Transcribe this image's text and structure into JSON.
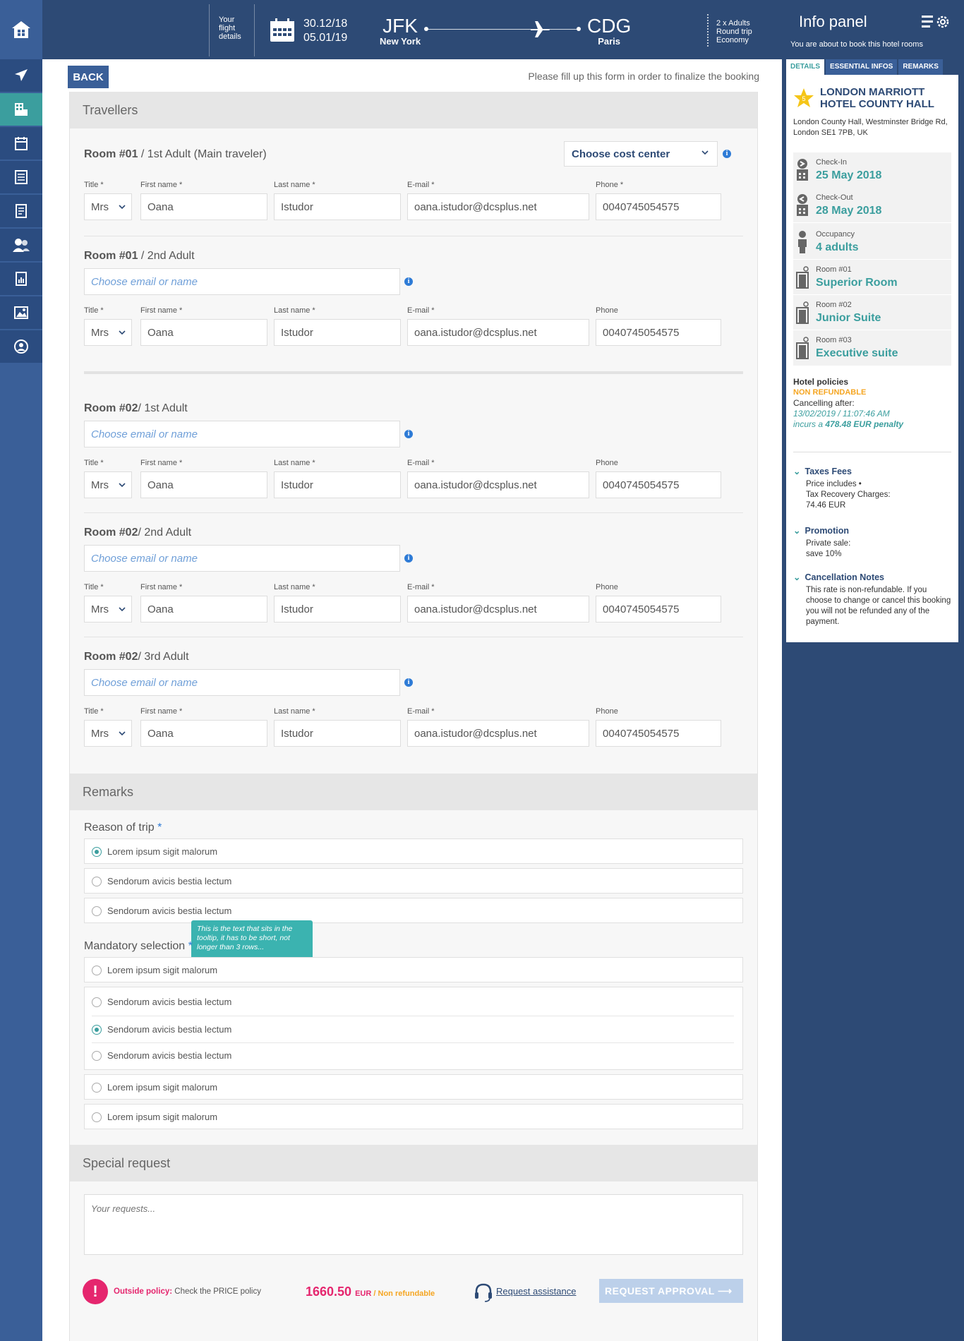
{
  "header": {
    "flight_label_1": "Your",
    "flight_label_2": "flight",
    "flight_label_3": "details",
    "date_out": "30.12/18",
    "date_return": "05.01/19",
    "origin_code": "JFK",
    "origin_city": "New York",
    "dest_code": "CDG",
    "dest_city": "Paris",
    "pax": "2 x Adults",
    "trip_type": "Round trip",
    "cabin": "Economy"
  },
  "colors": {
    "brand_navy": "#2d4a75",
    "nav_blue": "#3a5f98",
    "accent_teal": "#3b9e9e",
    "alert_pink": "#e5266e",
    "warning_orange": "#f5a623"
  },
  "nav": {
    "icons": [
      "home-icon",
      "plane-icon",
      "hotel-icon",
      "calendar-icon",
      "document-icon",
      "invoice-icon",
      "users-icon",
      "report-icon",
      "image-icon",
      "profile-icon"
    ],
    "active": "hotel-icon"
  },
  "main": {
    "back_label": "BACK",
    "hint": "Please fill up this form in order to finalize the booking",
    "travellers_title": "Travellers",
    "cost_center": "Choose cost center",
    "chooser_placeholder": "Choose email or name",
    "labels": {
      "title_req": "Title *",
      "first_req": "First name *",
      "last_req": "Last name *",
      "email_req": "E-mail *",
      "phone_req": "Phone *",
      "phone": "Phone"
    },
    "travellers": [
      {
        "room": "Room #01",
        "who": " / 1st Adult (Main traveler)",
        "title": "Mrs",
        "first": "Oana",
        "last": "Istudor",
        "email": "oana.istudor@dcsplus.net",
        "phone": "0040745054575"
      },
      {
        "room": "Room #01",
        "who": " / 2nd Adult",
        "title": "Mrs",
        "first": "Oana",
        "last": "Istudor",
        "email": "oana.istudor@dcsplus.net",
        "phone": "0040745054575"
      },
      {
        "room": "Room #02",
        "who": "/ 1st Adult",
        "title": "Mrs",
        "first": "Oana",
        "last": "Istudor",
        "email": "oana.istudor@dcsplus.net",
        "phone": "0040745054575"
      },
      {
        "room": "Room #02",
        "who": "/ 2nd Adult",
        "title": "Mrs",
        "first": "Oana",
        "last": "Istudor",
        "email": "oana.istudor@dcsplus.net",
        "phone": "0040745054575"
      },
      {
        "room": "Room #02",
        "who": "/ 3rd Adult",
        "title": "Mrs",
        "first": "Oana",
        "last": "Istudor",
        "email": "oana.istudor@dcsplus.net",
        "phone": "0040745054575"
      }
    ],
    "remarks_title": "Remarks",
    "reason_title": "Reason of trip",
    "reason_options": [
      "Lorem ipsum sigit malorum",
      "Sendorum avicis bestia lectum",
      "Sendorum avicis bestia lectum"
    ],
    "reason_selected": 0,
    "tooltip": "This is the text that sits in the tooltip, it has to be short, not longer than 3 rows...",
    "mandatory_title": "Mandatory selection",
    "mandatory_options": [
      "Lorem ipsum sigit malorum",
      "Sendorum avicis bestia lectum",
      "Sendorum avicis bestia lectum",
      "Sendorum avicis bestia lectum",
      "Lorem ipsum sigit malorum",
      "Lorem ipsum sigit malorum"
    ],
    "mandatory_selected": 2,
    "req_star": "*",
    "special_title": "Special request",
    "special_placeholder": "Your requests...",
    "footer": {
      "alert_mark": "!",
      "policy_strong": "Outside policy:",
      "policy_text": " Check the PRICE policy",
      "price": "1660.50",
      "currency": "EUR",
      "price_sep": " / ",
      "non_refundable": "Non refundable",
      "assist": "Request assistance",
      "approval": "REQUEST APPROVAL"
    }
  },
  "info_panel": {
    "title": "Info panel",
    "subtitle": "You are about to book this hotel rooms",
    "tabs": [
      "DETAILS",
      "ESSENTIAL INFOS",
      "REMARKS"
    ],
    "active_tab": 0,
    "stars": "5",
    "hotel_name": "LONDON MARRIOTT HOTEL COUNTY HALL",
    "hotel_address": "London County Hall, Westminster Bridge Rd, London SE1 7PB, UK",
    "checkin_label": "Check-In",
    "checkin": "25 May 2018",
    "checkout_label": "Check-Out",
    "checkout": "28 May 2018",
    "occupancy_label": "Occupancy",
    "occupancy": "4 adults",
    "rooms": [
      {
        "label": "Room #01",
        "type": "Superior Room"
      },
      {
        "label": "Room #02",
        "type": "Junior Suite"
      },
      {
        "label": "Room #03",
        "type": "Executive suite"
      }
    ],
    "policies_title": "Hotel policies",
    "non_refundable": "NON REFUNDABLE",
    "cancelling_after": "Cancelling after:",
    "cancel_date": "13/02/2019  /  11:07:46 AM",
    "penalty_prefix": "incurs a ",
    "penalty_amount": "478.48 EUR penalty",
    "taxes_title": "Taxes Fees",
    "taxes_line1": "Price includes •",
    "taxes_line2": "Tax Recovery Charges:",
    "taxes_line3": "74.46 EUR",
    "promo_title": "Promotion",
    "promo_line1": "Private sale:",
    "promo_line2": "save 10%",
    "cancel_title": "Cancellation Notes",
    "cancel_text": "This rate is non-refundable. If you choose to change or cancel this booking you will not be refunded any of the payment."
  }
}
